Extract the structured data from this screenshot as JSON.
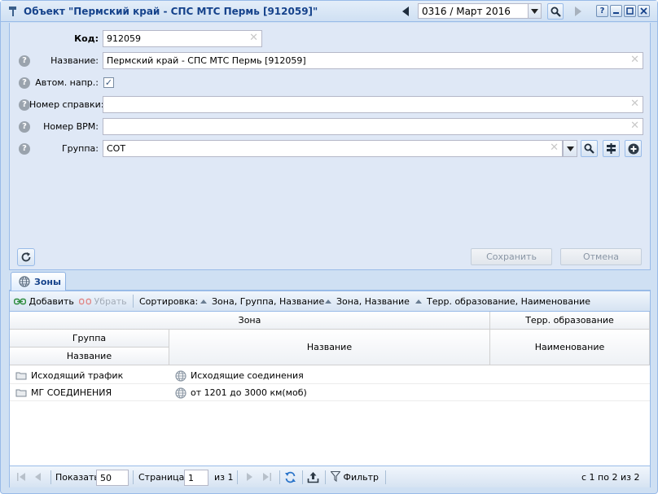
{
  "window": {
    "title": "Объект \"Пермский край - СПС МТС Пермь [912059]\"",
    "period": "0316 / Март 2016",
    "help_label": "?"
  },
  "form": {
    "code_label": "Код:",
    "code_value": "912059",
    "name_label": "Название:",
    "name_value": "Пермский край - СПС МТС Пермь [912059]",
    "auto_label": "Автом. напр.:",
    "auto_checked": true,
    "ref_label": "Номер справки:",
    "ref_value": "",
    "vrm_label": "Номер ВРМ:",
    "vrm_value": "",
    "group_label": "Группа:",
    "group_value": "СОТ",
    "save_label": "Сохранить",
    "cancel_label": "Отмена"
  },
  "tabs": [
    {
      "label": "Зоны",
      "icon": "globe-icon",
      "active": true
    }
  ],
  "grid_toolbar": {
    "add_label": "Добавить",
    "remove_label": "Убрать",
    "sort_label": "Сортировка:",
    "sorts": [
      "Зона, Группа, Название",
      "Зона, Название",
      "Терр. образование, Наименование"
    ]
  },
  "grid": {
    "headers": {
      "zone": "Зона",
      "territory": "Терр. образование",
      "group": "Группа",
      "group_name": "Название",
      "zone_name": "Название",
      "territory_name": "Наименование"
    },
    "rows": [
      {
        "group_name": "Исходящий трафик",
        "zone_name": "Исходящие соединения",
        "territory_name": ""
      },
      {
        "group_name": "МГ СОЕДИНЕНИЯ",
        "zone_name": "от 1201 до 3000 км(моб)",
        "territory_name": ""
      }
    ]
  },
  "pager": {
    "show_label": "Показать",
    "page_size": "50",
    "page_label": "Страница",
    "page": "1",
    "of_label": "из 1",
    "filter_label": "Фильтр",
    "summary": "с 1 по 2 из 2"
  },
  "colors": {
    "window_bg": "#cfe0f3",
    "title_text": "#15428b",
    "panel_bg": "#dfe8f6",
    "border": "#99bbe8"
  }
}
